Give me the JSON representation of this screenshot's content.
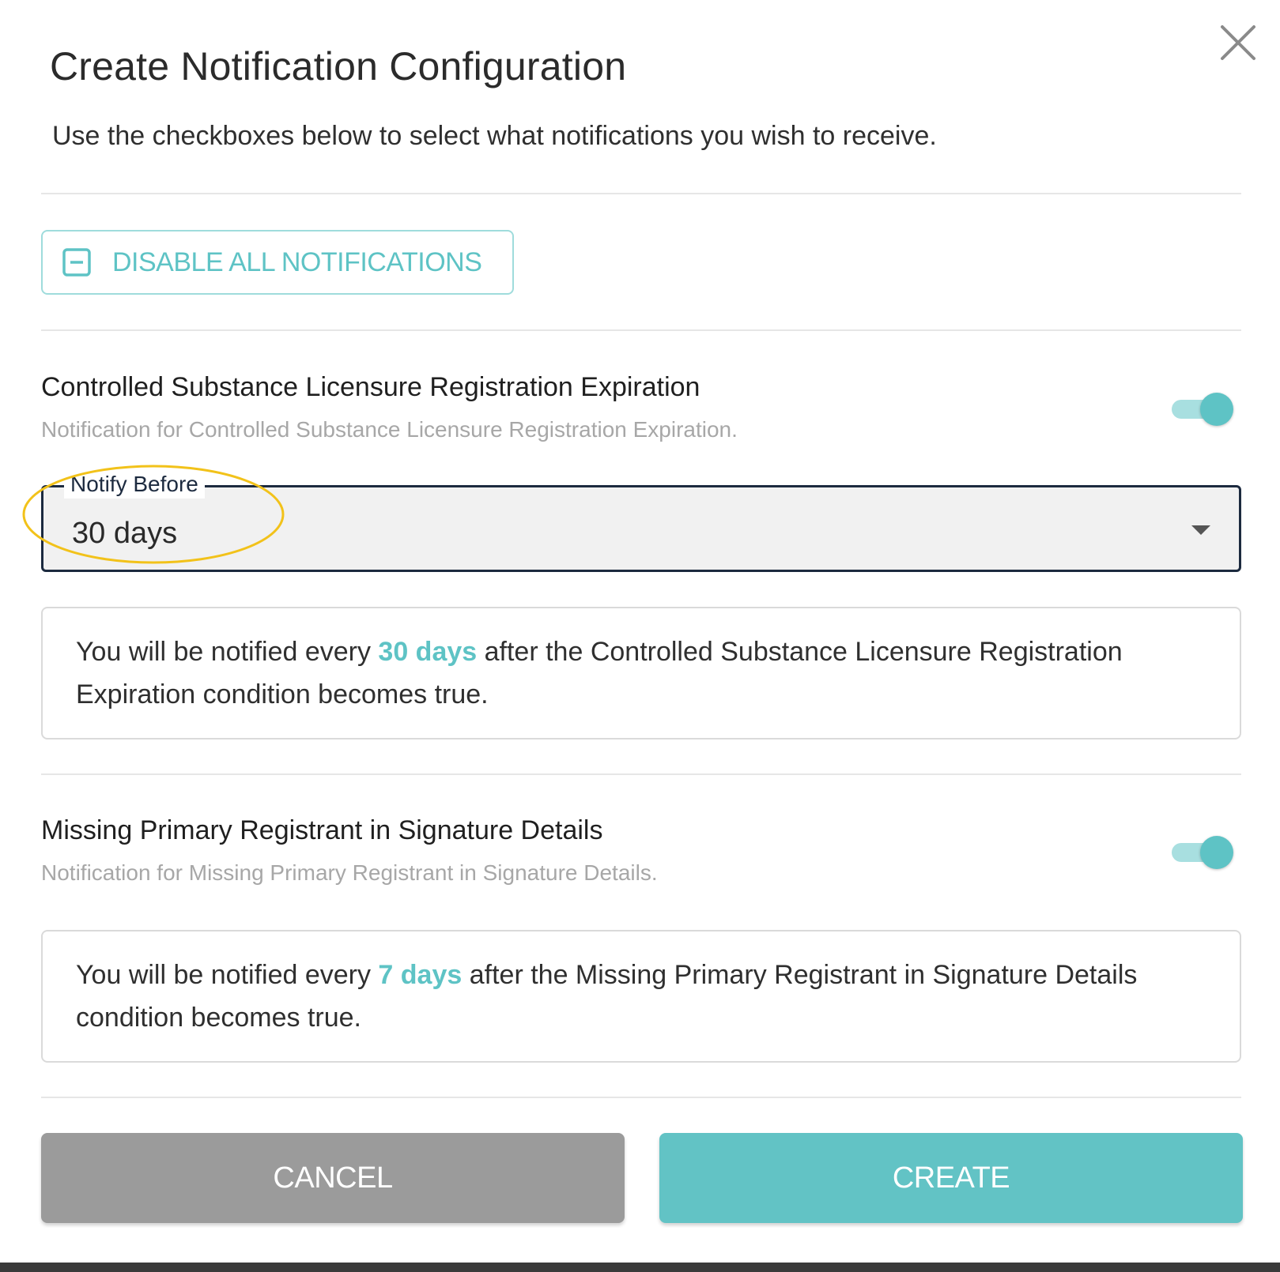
{
  "dialog": {
    "title": "Create Notification Configuration",
    "subtitle": "Use the checkboxes below to select what notifications you wish to receive.",
    "close_icon": "close-icon",
    "disable_all_label": "DISABLE ALL NOTIFICATIONS",
    "disable_all_icon": "minus-square-icon"
  },
  "notifications": [
    {
      "title": "Controlled Substance Licensure Registration Expiration",
      "description": "Notification for Controlled Substance Licensure Registration Expiration.",
      "enabled": true,
      "notify_before": {
        "label": "Notify Before",
        "value": "30 days"
      },
      "info": {
        "prefix": "You will be notified every ",
        "highlight": "30 days",
        "suffix": " after the Controlled Substance Licensure Registration Expiration condition becomes true."
      }
    },
    {
      "title": "Missing Primary Registrant in Signature Details",
      "description": "Notification for Missing Primary Registrant in Signature Details.",
      "enabled": true,
      "info": {
        "prefix": "You will be notified every ",
        "highlight": "7 days",
        "suffix": " after the Missing Primary Registrant in Signature Details condition becomes true."
      }
    }
  ],
  "footer": {
    "cancel_label": "CANCEL",
    "create_label": "CREATE"
  },
  "colors": {
    "accent": "#5ec3c5",
    "accent_light": "#a8dfe0",
    "select_border": "#1c2a3f",
    "cancel_bg": "#9b9b9b",
    "annotation_ring": "#f2c21a"
  }
}
